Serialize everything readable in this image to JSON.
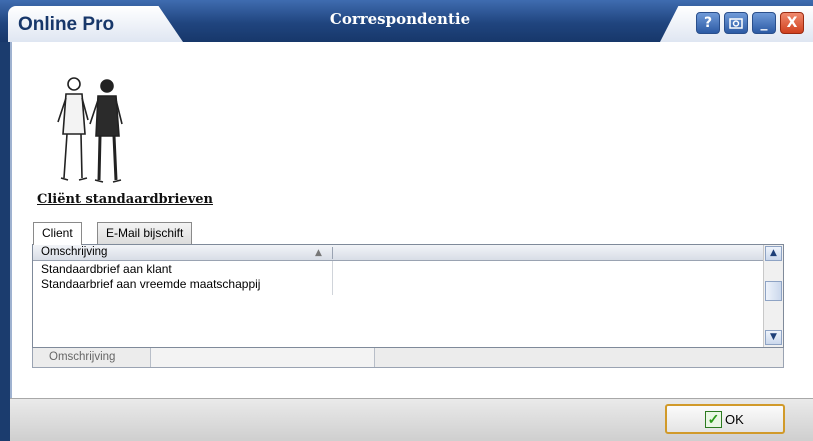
{
  "app": {
    "name": "Online Pro",
    "window_title": "Correspondentie"
  },
  "title_controls": {
    "help": "?",
    "minimize": "_",
    "close": "X"
  },
  "section": {
    "heading": "Cliënt standaardbrieven"
  },
  "tabs": [
    {
      "label": "Client",
      "active": true
    },
    {
      "label": "E-Mail bijschift",
      "active": false
    }
  ],
  "grid": {
    "column": "Omschrijving",
    "rows": [
      "Standaardbrief aan klant",
      "Standaarbrief aan vreemde maatschappij"
    ],
    "footer_label": "Omschrijving"
  },
  "ok_button": {
    "label": "OK"
  },
  "colors": {
    "accent_blue": "#1b3c6e",
    "ok_border": "#d19a2a",
    "check_green": "#2c9a19"
  }
}
